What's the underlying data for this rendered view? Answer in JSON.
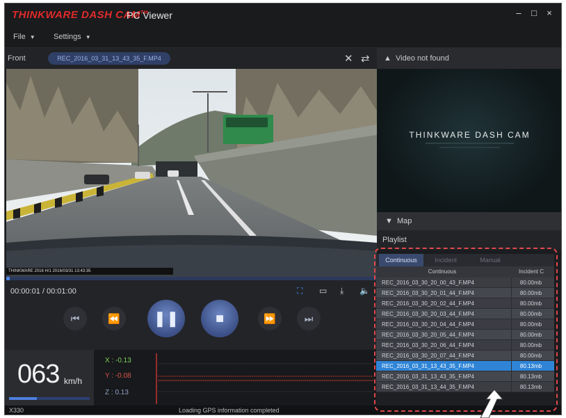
{
  "app": {
    "brand": "THINKWARE DASH CAM",
    "brand_tm": "TM",
    "product": "PC Viewer"
  },
  "window_controls": {
    "minimize": "–",
    "maximize": "□",
    "close": "×"
  },
  "menu": [
    {
      "label": "File"
    },
    {
      "label": "Settings"
    }
  ],
  "video_header": {
    "label": "Front",
    "file": "REC_2016_03_31_13_43_35_F.MP4"
  },
  "video": {
    "osd": "THINKWARE   2016   H/1   2016/03/31 13:43:35",
    "progress": 0.01
  },
  "controls": {
    "time": "00:00:01 / 00:01:00"
  },
  "speed": {
    "value": "063",
    "unit": "km/h"
  },
  "gsensor": {
    "x": "X : -0.13",
    "y": "Y : -0.08",
    "z": "Z : 0.13"
  },
  "status": {
    "left": "X330",
    "message": "Loading GPS information completed"
  },
  "right_panel": {
    "video_header": "Video not found",
    "preview_logo": "THINKWARE DASH CAM",
    "map": "Map",
    "playlist": "Playlist"
  },
  "playlist": {
    "tabs": [
      "Continuous",
      "Incident",
      "Manual",
      ""
    ],
    "columns": [
      "Continuous",
      "Incident C"
    ],
    "rows": [
      {
        "file": "REC_2016_03_30_20_00_43_F.MP4",
        "size": "80.00mb"
      },
      {
        "file": "REC_2016_03_30_20_01_44_F.MP4",
        "size": "80.00mb"
      },
      {
        "file": "REC_2016_03_30_20_02_44_F.MP4",
        "size": "80.00mb"
      },
      {
        "file": "REC_2016_03_30_20_03_44_F.MP4",
        "size": "80.00mb"
      },
      {
        "file": "REC_2016_03_30_20_04_44_F.MP4",
        "size": "80.00mb"
      },
      {
        "file": "REC_2016_03_30_20_05_44_F.MP4",
        "size": "80.00mb"
      },
      {
        "file": "REC_2016_03_30_20_06_44_F.MP4",
        "size": "80.00mb"
      },
      {
        "file": "REC_2016_03_30_20_07_44_F.MP4",
        "size": "80.00mb"
      },
      {
        "file": "REC_2016_03_31_13_43_35_F.MP4",
        "size": "80.13mb"
      },
      {
        "file": "REC_2016_03_31_13_43_35_F.MP4",
        "size": "80.13mb"
      },
      {
        "file": "REC_2016_03_31_13_44_35_F.MP4",
        "size": "80.13mb"
      }
    ],
    "selected_index": 8
  },
  "colors": {
    "brand_red": "#e02a2a",
    "accent_blue": "#2f84d6",
    "annotation_red": "#e0484b"
  }
}
